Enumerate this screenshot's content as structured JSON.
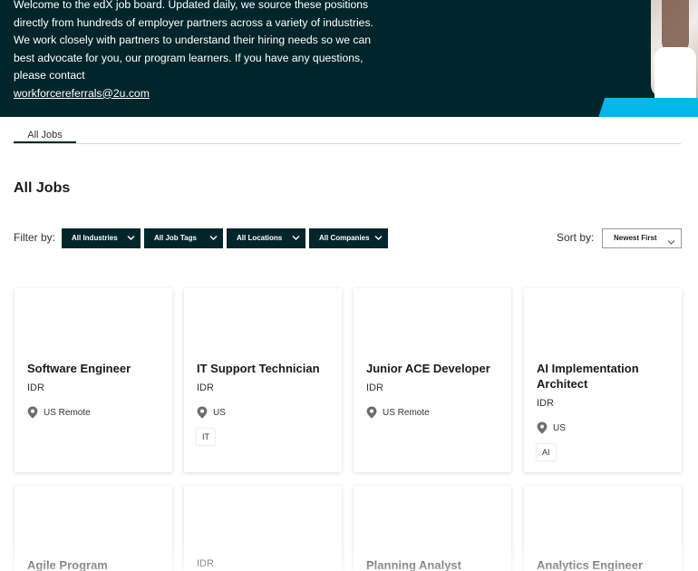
{
  "hero": {
    "text": "Welcome to the edX job board. Updated daily, we source these positions directly from hundreds of employer partners across a variety of industries. We work closely with partners to understand their hiring needs so we can best advocate for you, our program learners. If you have any questions, please contact",
    "email": "workforcereferrals@2u.com",
    "colors": {
      "background": "#00262b",
      "accent": "#05b6e8"
    }
  },
  "tabs": [
    {
      "label": "All Jobs",
      "active": true
    }
  ],
  "page_title": "All Jobs",
  "filters": {
    "label": "Filter by:",
    "industries": "All Industries",
    "job_tags": "All Job Tags",
    "locations": "All Locations",
    "companies": "All Companies"
  },
  "sort": {
    "label": "Sort by:",
    "value": "Newest First"
  },
  "jobs": [
    {
      "title": "Software Engineer",
      "company": "IDR",
      "location": "US Remote",
      "tag": ""
    },
    {
      "title": "IT Support Technician",
      "company": "IDR",
      "location": "US",
      "tag": "IT"
    },
    {
      "title": "Junior ACE Developer",
      "company": "IDR",
      "location": "US Remote",
      "tag": ""
    },
    {
      "title": "AI Implementation Architect",
      "company": "IDR",
      "location": "US",
      "tag": "AI"
    },
    {
      "title": "Agile Program",
      "company": "",
      "location": "",
      "tag": ""
    },
    {
      "title": "",
      "company": "IDR",
      "location": "",
      "tag": ""
    },
    {
      "title": "Planning Analyst",
      "company": "",
      "location": "",
      "tag": ""
    },
    {
      "title": "Analytics Engineer",
      "company": "",
      "location": "",
      "tag": ""
    }
  ]
}
